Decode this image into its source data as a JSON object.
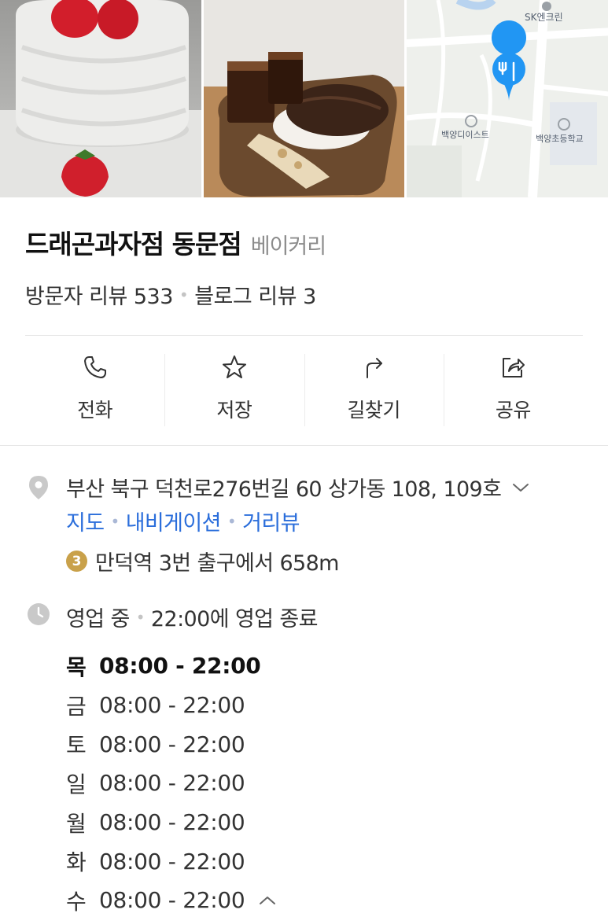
{
  "photos": [
    {
      "name": "cake-photo",
      "alt": "strawberry cake"
    },
    {
      "name": "bread-coffee-photo",
      "alt": "iced coffee and bread"
    },
    {
      "name": "map-thumbnail",
      "alt": "map"
    }
  ],
  "map": {
    "labels": [
      "SK엔크린",
      "백양디이스트",
      "백양초등학교"
    ],
    "pin_color": "#2196f3"
  },
  "place": {
    "name": "드래곤과자점 동문점",
    "category": "베이커리"
  },
  "reviews": {
    "visitor": "방문자 리뷰 533",
    "blog": "블로그 리뷰 3"
  },
  "actions": [
    {
      "label": "전화",
      "icon": "phone-icon"
    },
    {
      "label": "저장",
      "icon": "star-icon"
    },
    {
      "label": "길찾기",
      "icon": "directions-icon"
    },
    {
      "label": "공유",
      "icon": "share-icon"
    }
  ],
  "address": {
    "text": "부산 북구 덕천로276번길 60 상가동 108, 109호",
    "links": [
      "지도",
      "내비게이션",
      "거리뷰"
    ],
    "subway_line": "3",
    "subway_line_color": "#c9a14a",
    "subway_text": "만덕역 3번 출구에서 658m"
  },
  "hours": {
    "status": "영업 중",
    "closing": "22:00에 영업 종료",
    "days": [
      {
        "day": "목",
        "time": "08:00 - 22:00",
        "today": true
      },
      {
        "day": "금",
        "time": "08:00 - 22:00"
      },
      {
        "day": "토",
        "time": "08:00 - 22:00"
      },
      {
        "day": "일",
        "time": "08:00 - 22:00"
      },
      {
        "day": "월",
        "time": "08:00 - 22:00"
      },
      {
        "day": "화",
        "time": "08:00 - 22:00"
      },
      {
        "day": "수",
        "time": "08:00 - 22:00"
      }
    ]
  },
  "colors": {
    "link": "#2b6edb",
    "muted": "#8c8c8c",
    "divider": "#e6e6e6"
  }
}
